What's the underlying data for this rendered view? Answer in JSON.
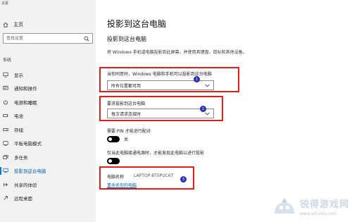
{
  "window": {
    "title": "设置"
  },
  "sidebar": {
    "home_label": "主页",
    "search_placeholder": "查找设置",
    "section_title": "系统",
    "items": [
      {
        "label": "显示",
        "icon": "monitor-icon"
      },
      {
        "label": "通知和操作",
        "icon": "notification-icon"
      },
      {
        "label": "电源和睡眠",
        "icon": "power-icon"
      },
      {
        "label": "电池",
        "icon": "battery-icon"
      },
      {
        "label": "存储",
        "icon": "storage-icon"
      },
      {
        "label": "平板电脑模式",
        "icon": "tablet-icon"
      },
      {
        "label": "多任务",
        "icon": "multitask-icon"
      },
      {
        "label": "投影到这台电脑",
        "icon": "project-icon",
        "selected": true
      },
      {
        "label": "共享的体验",
        "icon": "share-icon"
      },
      {
        "label": "远程桌面",
        "icon": "remote-desktop-icon"
      }
    ]
  },
  "main": {
    "page_title": "投影到这台电脑",
    "sub_heading": "投影到这台电脑",
    "description": "将 Windows 手机或电脑投影到此屏幕，并使用其键盘、鼠标和其他设备。",
    "availability": {
      "label": "当你同意时，Windows 电脑和手机可以投影到这台电脑",
      "value": "所有位置都可用"
    },
    "request": {
      "label": "要求投影到这台电脑",
      "value": "每次请求连接时"
    },
    "pin": {
      "label": "需要 PIN 才能进行配对",
      "state_text": "关",
      "on": false
    },
    "power": {
      "label": "仅当此电脑接通电源时，才能发现此电脑以进行投影"
    },
    "pc_name": {
      "label": "电脑名称",
      "value": "LAPTOP-8T5PUC6T"
    },
    "rename_link": "重命名你的电脑"
  },
  "annotations": {
    "markers": [
      "1",
      "2",
      "3"
    ],
    "box_color": "#e0201c",
    "marker_color": "#2b30b8"
  },
  "watermark": {
    "title": "锐得游戏网",
    "url": "www.ytruida.com"
  },
  "colors": {
    "accent": "#0078d7",
    "sidebar_bg": "#f2f2f2"
  }
}
